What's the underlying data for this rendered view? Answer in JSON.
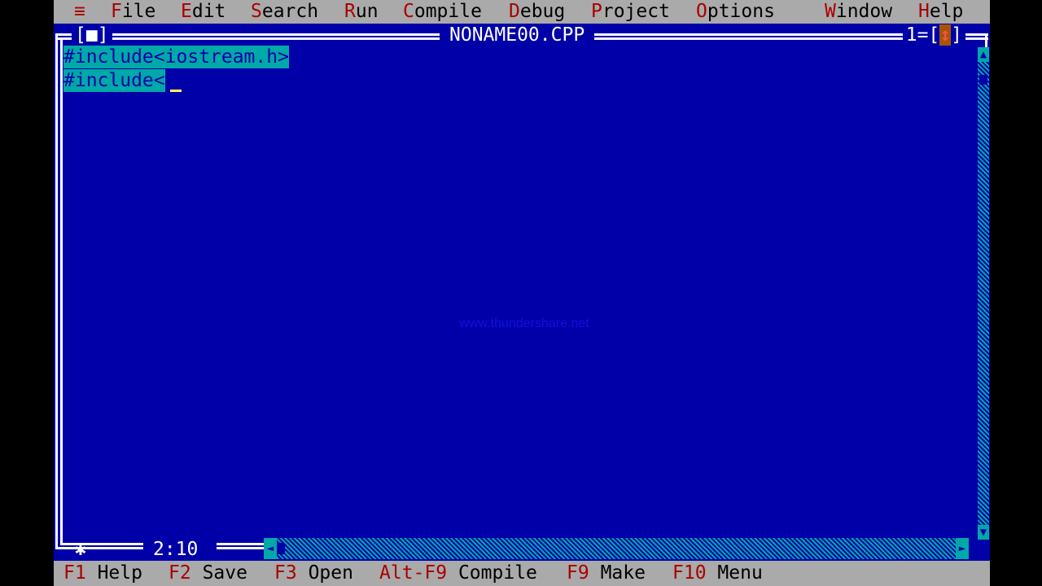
{
  "menubar": {
    "system": "≡",
    "items": [
      {
        "hot": "F",
        "rest": "ile"
      },
      {
        "hot": "E",
        "rest": "dit"
      },
      {
        "hot": "S",
        "rest": "earch"
      },
      {
        "hot": "R",
        "rest": "un"
      },
      {
        "hot": "C",
        "rest": "ompile"
      },
      {
        "hot": "D",
        "rest": "ebug"
      },
      {
        "hot": "P",
        "rest": "roject"
      },
      {
        "hot": "O",
        "rest": "ptions"
      },
      {
        "hot": "W",
        "rest": "indow"
      },
      {
        "hot": "H",
        "rest": "elp"
      }
    ]
  },
  "window": {
    "close_box": "[■]",
    "title": "NONAME00.CPP",
    "number": "1=",
    "zoom": "↕",
    "modified_marker": "✱",
    "cursor_position": "2:10"
  },
  "editor": {
    "lines": [
      "#include<iostream.h>",
      "#include<"
    ]
  },
  "watermark": "www.thundershare.net",
  "statusbar": {
    "items": [
      {
        "key": "F1",
        "label": "Help"
      },
      {
        "key": "F2",
        "label": "Save"
      },
      {
        "key": "F3",
        "label": "Open"
      },
      {
        "key": "Alt-F9",
        "label": "Compile"
      },
      {
        "key": "F9",
        "label": "Make"
      },
      {
        "key": "F10",
        "label": "Menu"
      }
    ]
  },
  "colors": {
    "editor_bg": "#0000a8",
    "menu_bg": "#aaaaaa",
    "hotkey": "#a80000",
    "selection": "#00a8a8"
  }
}
